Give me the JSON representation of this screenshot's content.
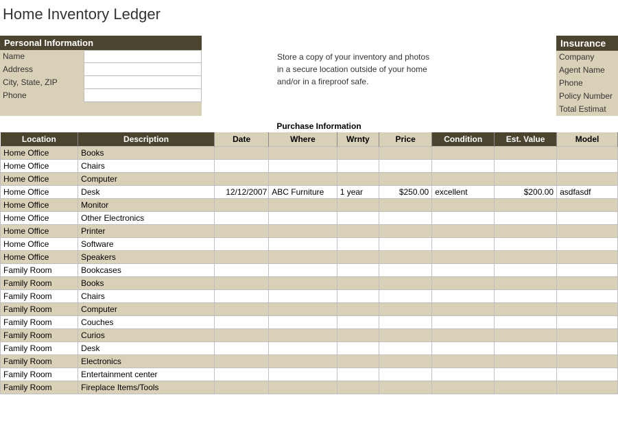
{
  "title": "Home Inventory Ledger",
  "personal": {
    "header": "Personal Information",
    "fields": [
      {
        "label": "Name",
        "value": ""
      },
      {
        "label": "Address",
        "value": ""
      },
      {
        "label": "City, State, ZIP",
        "value": ""
      },
      {
        "label": "Phone",
        "value": ""
      }
    ]
  },
  "note": {
    "line1": "Store a copy of your inventory and photos",
    "line2": "in a secure location outside of your home",
    "line3": "and/or in a fireproof safe."
  },
  "insurance": {
    "header": "Insurance",
    "rows": [
      "Company",
      "Agent Name",
      "Phone",
      "Policy Number",
      "Total Estimat"
    ]
  },
  "purchase_section_label": "Purchase Information",
  "columns": {
    "location": "Location",
    "description": "Description",
    "date": "Date",
    "where": "Where",
    "wrnty": "Wrnty",
    "price": "Price",
    "condition": "Condition",
    "est_value": "Est. Value",
    "model": "Model"
  },
  "rows": [
    {
      "location": "Home Office",
      "description": "Books"
    },
    {
      "location": "Home Office",
      "description": "Chairs"
    },
    {
      "location": "Home Office",
      "description": "Computer"
    },
    {
      "location": "Home Office",
      "description": "Desk",
      "date": "12/12/2007",
      "where": "ABC Furniture",
      "wrnty": "1 year",
      "price": "$250.00",
      "condition": "excellent",
      "est_value": "$200.00",
      "model": "asdfasdf"
    },
    {
      "location": "Home Office",
      "description": "Monitor"
    },
    {
      "location": "Home Office",
      "description": "Other Electronics"
    },
    {
      "location": "Home Office",
      "description": "Printer"
    },
    {
      "location": "Home Office",
      "description": "Software"
    },
    {
      "location": "Home Office",
      "description": "Speakers"
    },
    {
      "location": "Family Room",
      "description": "Bookcases"
    },
    {
      "location": "Family Room",
      "description": "Books"
    },
    {
      "location": "Family Room",
      "description": "Chairs"
    },
    {
      "location": "Family Room",
      "description": "Computer"
    },
    {
      "location": "Family Room",
      "description": "Couches"
    },
    {
      "location": "Family Room",
      "description": "Curios"
    },
    {
      "location": "Family Room",
      "description": "Desk"
    },
    {
      "location": "Family Room",
      "description": "Electronics"
    },
    {
      "location": "Family Room",
      "description": "Entertainment center"
    },
    {
      "location": "Family Room",
      "description": "Fireplace Items/Tools"
    }
  ]
}
